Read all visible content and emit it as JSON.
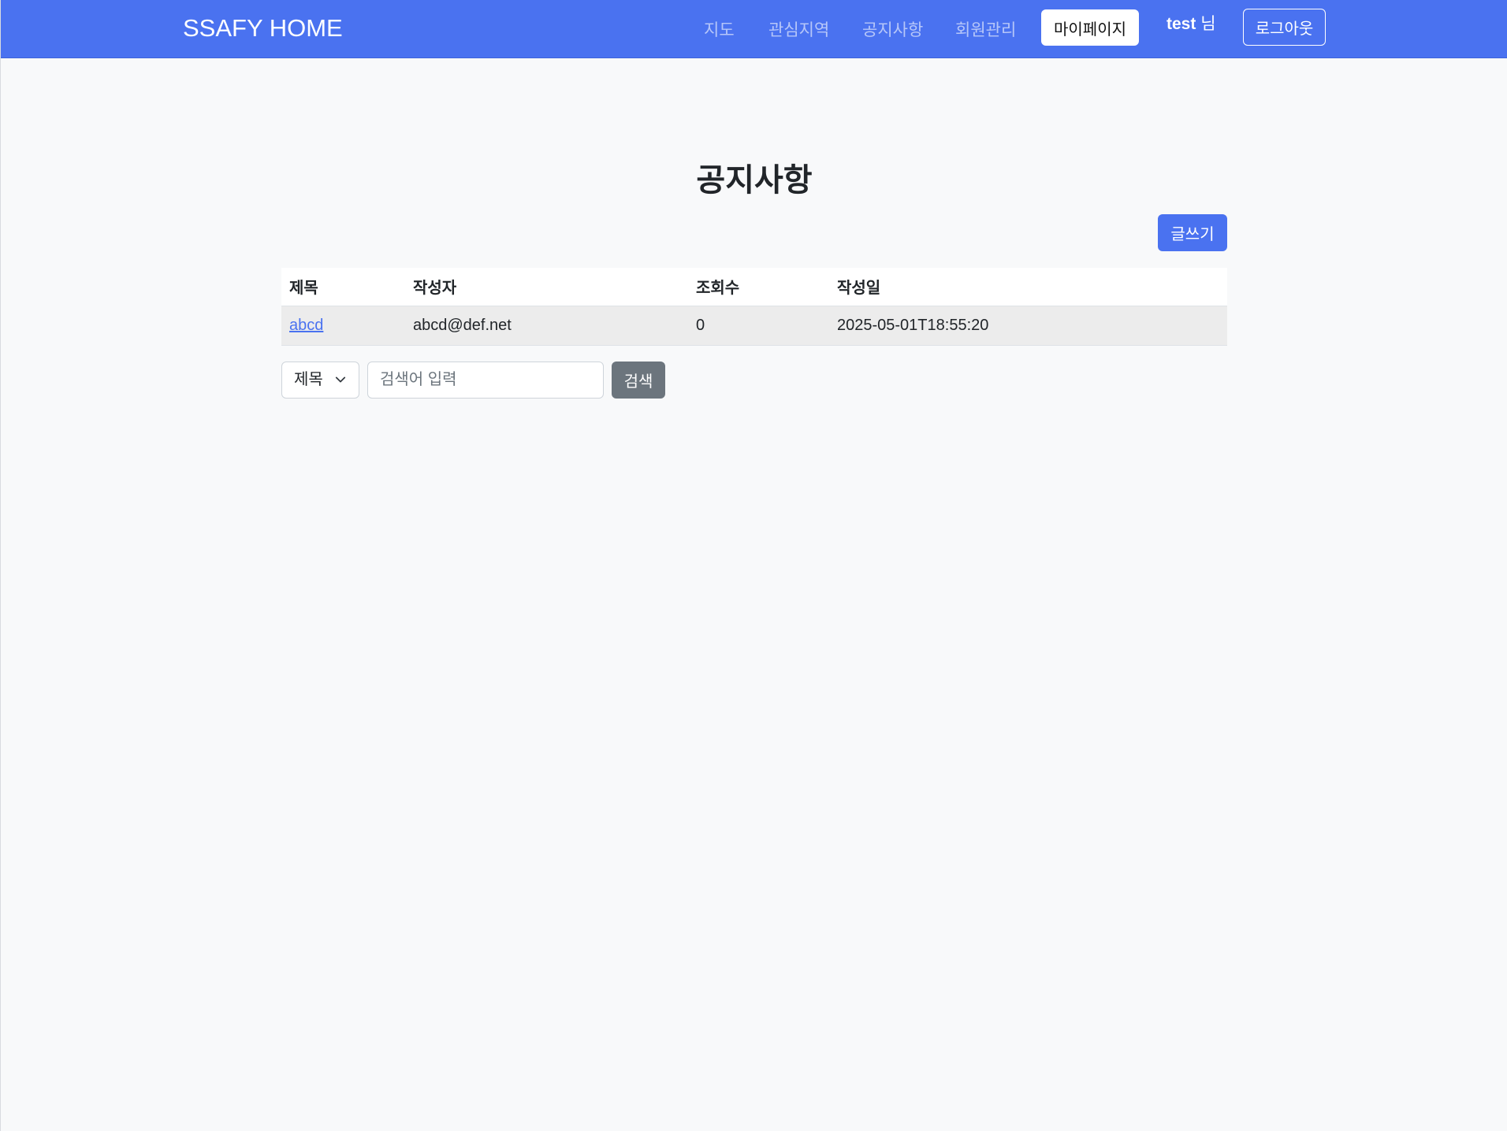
{
  "navbar": {
    "brand": "SSAFY HOME",
    "links": [
      "지도",
      "관심지역",
      "공지사항",
      "회원관리"
    ],
    "mypage_label": "마이페이지",
    "user_name": "test",
    "user_suffix": " 님",
    "logout_label": "로그아웃",
    "background_color": "#4a72f0"
  },
  "main": {
    "title": "공지사항",
    "write_label": "글쓰기",
    "table": {
      "headers": [
        "제목",
        "작성자",
        "조회수",
        "작성일"
      ],
      "rows": [
        [
          "abcd",
          "abcd@def.net",
          "0",
          "2025-05-01T18:55:20"
        ]
      ]
    },
    "search": {
      "field_selected": "제목",
      "placeholder": "검색어 입력",
      "button_label": "검색"
    }
  },
  "colors": {
    "primary": "#4a72f0",
    "secondary": "#6c757d",
    "page_background": "#f8f9fa"
  }
}
